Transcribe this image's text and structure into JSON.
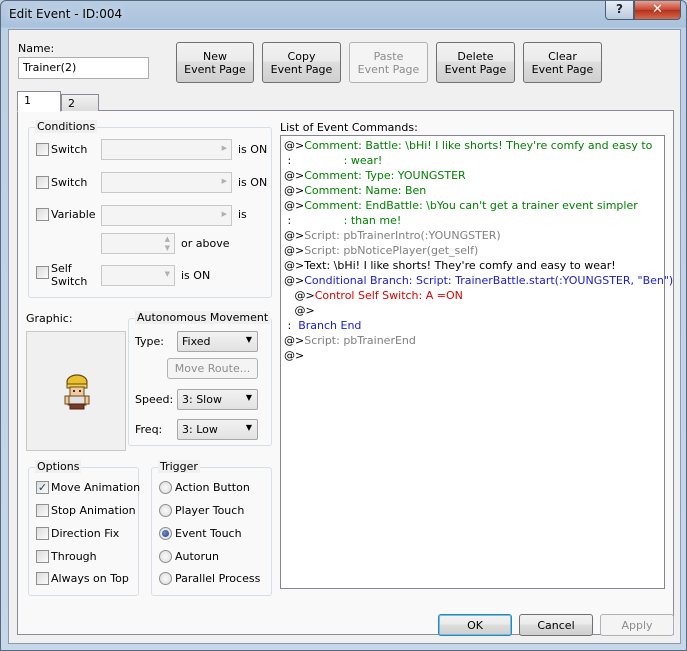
{
  "window": {
    "title": "Edit Event - ID:004",
    "help_glyph": "?",
    "close_glyph": "✕"
  },
  "name_section": {
    "label": "Name:",
    "value": "Trainer(2)"
  },
  "page_buttons": {
    "new": [
      "New",
      "Event Page"
    ],
    "copy": [
      "Copy",
      "Event Page"
    ],
    "paste": [
      "Paste",
      "Event Page"
    ],
    "delete": [
      "Delete",
      "Event Page"
    ],
    "clear": [
      "Clear",
      "Event Page"
    ]
  },
  "tabs": [
    "1",
    "2"
  ],
  "conditions": {
    "title": "Conditions",
    "switch1": {
      "label": "Switch",
      "suffix": "is ON",
      "checked": false
    },
    "switch2": {
      "label": "Switch",
      "suffix": "is ON",
      "checked": false
    },
    "variable": {
      "label": "Variable",
      "suffix": "is",
      "checked": false,
      "or_above": "or above"
    },
    "self_switch": {
      "label_line1": "Self",
      "label_line2": "Switch",
      "suffix": "is ON",
      "checked": false
    }
  },
  "graphic": {
    "label": "Graphic:",
    "sprite": "youngster-trainer-sprite"
  },
  "autonomous": {
    "title": "Autonomous Movement",
    "type_label": "Type:",
    "type_value": "Fixed",
    "move_route": "Move Route...",
    "speed_label": "Speed:",
    "speed_value": "3: Slow",
    "freq_label": "Freq:",
    "freq_value": "3: Low"
  },
  "options": {
    "title": "Options",
    "items": [
      {
        "label": "Move Animation",
        "checked": true
      },
      {
        "label": "Stop Animation",
        "checked": false
      },
      {
        "label": "Direction Fix",
        "checked": false
      },
      {
        "label": "Through",
        "checked": false
      },
      {
        "label": "Always on Top",
        "checked": false
      }
    ]
  },
  "trigger": {
    "title": "Trigger",
    "items": [
      {
        "label": "Action Button",
        "selected": false
      },
      {
        "label": "Player Touch",
        "selected": false
      },
      {
        "label": "Event Touch",
        "selected": true
      },
      {
        "label": "Autorun",
        "selected": false
      },
      {
        "label": "Parallel Process",
        "selected": false
      }
    ]
  },
  "commands": {
    "title": "List of Event Commands:",
    "lines": [
      {
        "prefix": "@>",
        "text": "Comment: Battle: \\bHi! I like shorts! They're comfy and easy to",
        "color": "green"
      },
      {
        "prefix": " :",
        "text": "               : wear!",
        "color": "green"
      },
      {
        "prefix": "@>",
        "text": "Comment: Type: YOUNGSTER",
        "color": "green"
      },
      {
        "prefix": "@>",
        "text": "Comment: Name: Ben",
        "color": "green"
      },
      {
        "prefix": "@>",
        "text": "Comment: EndBattle: \\bYou can't get a trainer event simpler",
        "color": "green"
      },
      {
        "prefix": " :",
        "text": "               : than me!",
        "color": "green"
      },
      {
        "prefix": "@>",
        "text": "Script: pbTrainerIntro(:YOUNGSTER)",
        "color": "gray"
      },
      {
        "prefix": "@>",
        "text": "Script: pbNoticePlayer(get_self)",
        "color": "gray"
      },
      {
        "prefix": "@>",
        "text": "Text: \\bHi! I like shorts! They're comfy and easy to wear!",
        "color": "black"
      },
      {
        "prefix": "@>",
        "text": "Conditional Branch: Script: TrainerBattle.start(:YOUNGSTER, \"Ben\")",
        "color": "blue"
      },
      {
        "prefix": "   @>",
        "text": "Control Self Switch: A =ON",
        "color": "red"
      },
      {
        "prefix": "   @>",
        "text": "",
        "color": "black"
      },
      {
        "prefix": " :",
        "text": "  Branch End",
        "color": "blue"
      },
      {
        "prefix": "@>",
        "text": "Script: pbTrainerEnd",
        "color": "gray"
      },
      {
        "prefix": "@>",
        "text": "",
        "color": "black"
      }
    ]
  },
  "footer": {
    "ok": "OK",
    "cancel": "Cancel",
    "apply": "Apply"
  }
}
